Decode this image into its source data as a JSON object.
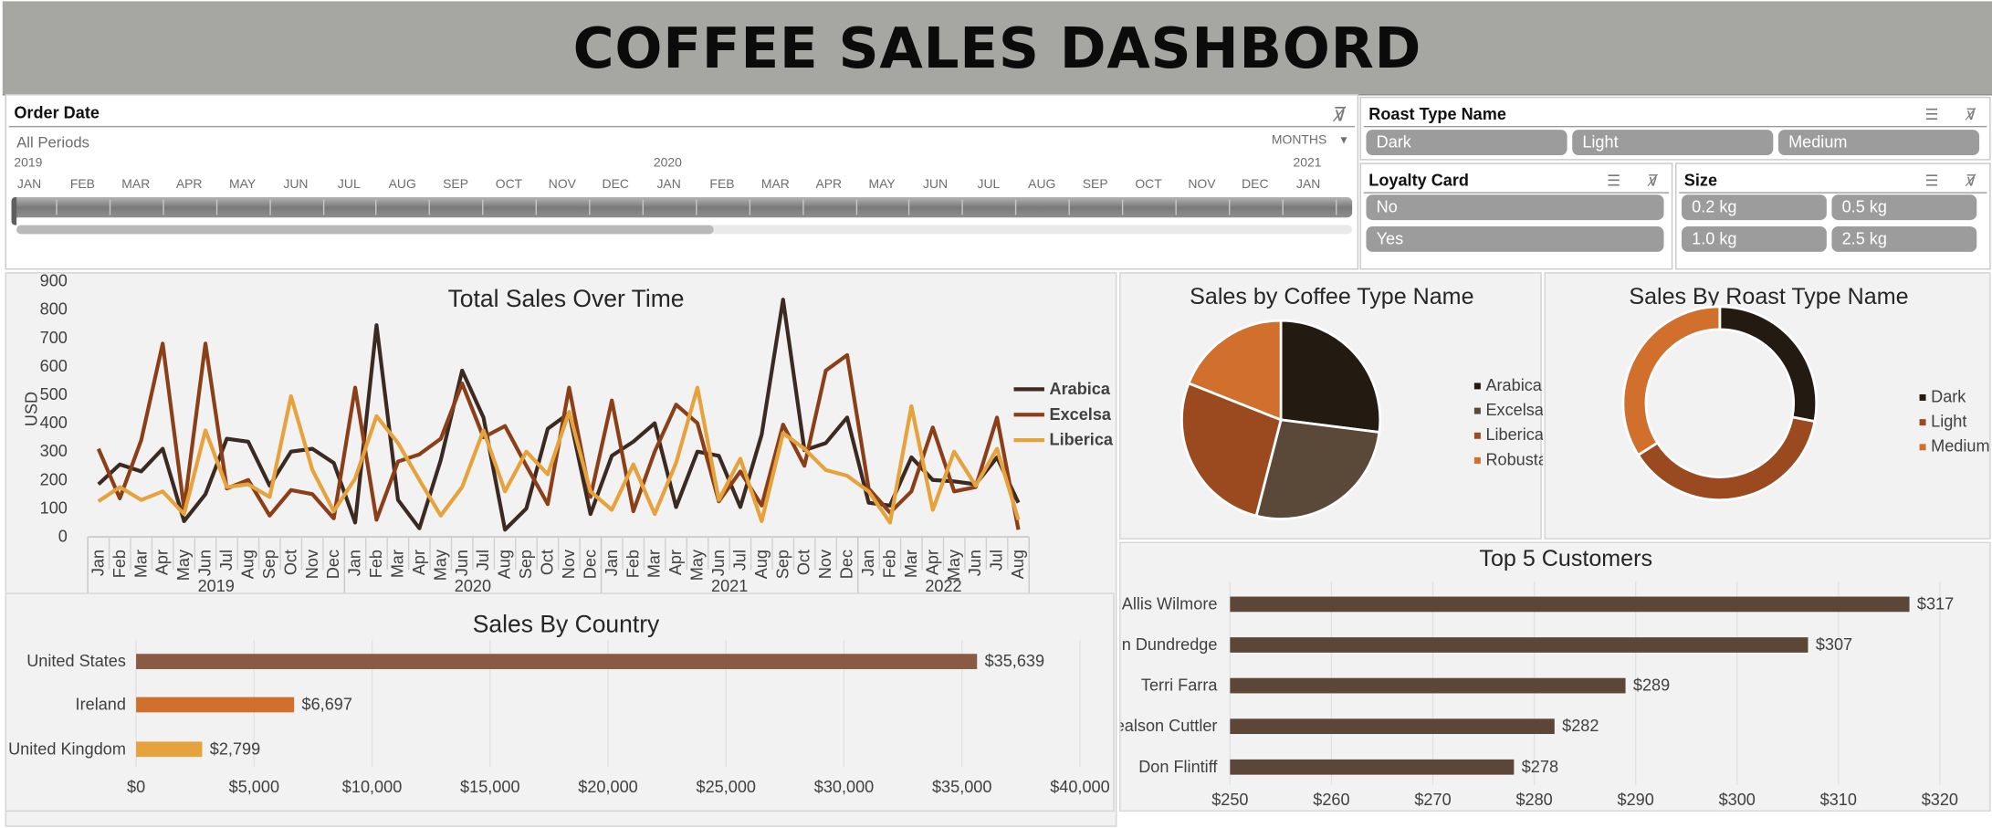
{
  "header": {
    "title": "COFFEE SALES DASHBORD"
  },
  "order_date": {
    "title": "Order Date",
    "period": "All Periods",
    "unit": "MONTHS",
    "years": [
      "2019",
      "2020",
      "2021"
    ],
    "months": [
      "JAN",
      "FEB",
      "MAR",
      "APR",
      "MAY",
      "JUN",
      "JUL",
      "AUG",
      "SEP",
      "OCT",
      "NOV",
      "DEC",
      "JAN",
      "FEB",
      "MAR",
      "APR",
      "MAY",
      "JUN",
      "JUL",
      "AUG",
      "SEP",
      "OCT",
      "NOV",
      "DEC",
      "JAN"
    ]
  },
  "roast_slicer": {
    "title": "Roast Type Name",
    "items": [
      "Dark",
      "Light",
      "Medium"
    ]
  },
  "loyalty_slicer": {
    "title": "Loyalty Card",
    "items": [
      "No",
      "Yes"
    ]
  },
  "size_slicer": {
    "title": "Size",
    "items": [
      "0.2 kg",
      "0.5 kg",
      "1.0 kg",
      "2.5 kg"
    ]
  },
  "icons": {
    "filter_clear": "filter-clear-icon",
    "multi_select": "multi-select-icon",
    "dropdown": "dropdown-arrow-icon"
  },
  "colors": {
    "header_bg": "#a6a7a2",
    "arabica": "#3b2a22",
    "excelsa": "#8b3f19",
    "liberica": "#e6a23c",
    "robusta": "#d0702c",
    "dark": "#231a12",
    "light": "#9a4a1e",
    "medium": "#d0702c",
    "customer_bar": "#5b4638",
    "us_bar": "#8a5a44",
    "ireland_bar": "#d0702c",
    "uk_bar": "#e6a23c"
  },
  "chart_data": [
    {
      "id": "total_sales",
      "type": "line",
      "title": "Total Sales Over Time",
      "ylabel": "USD",
      "ylim": [
        0,
        900
      ],
      "yticks": [
        0,
        100,
        200,
        300,
        400,
        500,
        600,
        700,
        800,
        900
      ],
      "month_labels": [
        "Jan",
        "Feb",
        "Mar",
        "Apr",
        "May",
        "Jun",
        "Jul",
        "Aug",
        "Sep",
        "Oct",
        "Nov",
        "Dec",
        "Jan",
        "Feb",
        "Mar",
        "Apr",
        "May",
        "Jun",
        "Jul",
        "Aug",
        "Sep",
        "Oct",
        "Nov",
        "Dec",
        "Jan",
        "Feb",
        "Mar",
        "Apr",
        "May",
        "Jun",
        "Jul",
        "Aug",
        "Sep",
        "Oct",
        "Nov",
        "Dec",
        "Jan",
        "Feb",
        "Mar",
        "Apr",
        "May",
        "Jun",
        "Jul",
        "Aug"
      ],
      "year_groups": [
        {
          "label": "2019",
          "count": 12
        },
        {
          "label": "2020",
          "count": 12
        },
        {
          "label": "2021",
          "count": 12
        },
        {
          "label": "2022",
          "count": 8
        }
      ],
      "legend_position": "right",
      "series": [
        {
          "name": "Arabica",
          "values": [
            185,
            255,
            230,
            310,
            55,
            150,
            345,
            335,
            180,
            300,
            310,
            260,
            50,
            745,
            130,
            30,
            270,
            585,
            420,
            25,
            100,
            380,
            435,
            80,
            285,
            335,
            400,
            105,
            300,
            285,
            105,
            360,
            835,
            305,
            330,
            420,
            120,
            110,
            280,
            200,
            195,
            185,
            280,
            120
          ]
        },
        {
          "name": "Excelsa",
          "values": [
            310,
            135,
            340,
            680,
            100,
            680,
            170,
            200,
            75,
            165,
            150,
            65,
            525,
            60,
            265,
            290,
            345,
            540,
            350,
            390,
            250,
            115,
            525,
            140,
            480,
            90,
            300,
            465,
            400,
            125,
            230,
            110,
            395,
            250,
            585,
            640,
            170,
            85,
            160,
            385,
            160,
            175,
            420,
            25
          ]
        },
        {
          "name": "Liberica",
          "values": [
            125,
            175,
            130,
            160,
            80,
            375,
            175,
            185,
            140,
            495,
            235,
            90,
            205,
            425,
            330,
            200,
            75,
            175,
            375,
            160,
            300,
            220,
            440,
            160,
            95,
            255,
            80,
            260,
            525,
            130,
            275,
            55,
            365,
            310,
            235,
            215,
            160,
            50,
            460,
            95,
            300,
            180,
            310,
            60
          ]
        }
      ]
    },
    {
      "id": "coffee_type",
      "type": "pie",
      "title": "Sales by Coffee Type Name",
      "legend_position": "right",
      "categories": [
        "Arabica",
        "Excelsa",
        "Liberica",
        "Robusta"
      ],
      "values": [
        27,
        27,
        27,
        19
      ]
    },
    {
      "id": "roast_type",
      "type": "pie",
      "title": "Sales By Roast Type Name",
      "legend_position": "right",
      "categories": [
        "Dark",
        "Light",
        "Medium"
      ],
      "values": [
        28,
        38,
        34
      ]
    },
    {
      "id": "sales_by_country",
      "type": "bar",
      "title": "Sales By Country",
      "categories": [
        "United States",
        "Ireland",
        "United Kingdom"
      ],
      "values": [
        35639,
        6697,
        2799
      ],
      "value_labels": [
        "$35,639",
        "$6,697",
        "$2,799"
      ],
      "xlim": [
        0,
        40000
      ],
      "xtick_labels": [
        "$0",
        "$5,000",
        "$10,000",
        "$15,000",
        "$20,000",
        "$25,000",
        "$30,000",
        "$35,000",
        "$40,000"
      ]
    },
    {
      "id": "top_customers",
      "type": "bar",
      "title": "Top 5 Customers",
      "categories": [
        "Allis Wilmore",
        "Brenn Dundredge",
        "Terri Farra",
        "Nealson Cuttler",
        "Don Flintiff"
      ],
      "values": [
        317,
        307,
        289,
        282,
        278
      ],
      "value_labels": [
        "$317",
        "$307",
        "$289",
        "$282",
        "$278"
      ],
      "xlim": [
        250,
        320
      ],
      "xtick_labels": [
        "$250",
        "$260",
        "$270",
        "$280",
        "$290",
        "$300",
        "$310",
        "$320"
      ]
    }
  ]
}
